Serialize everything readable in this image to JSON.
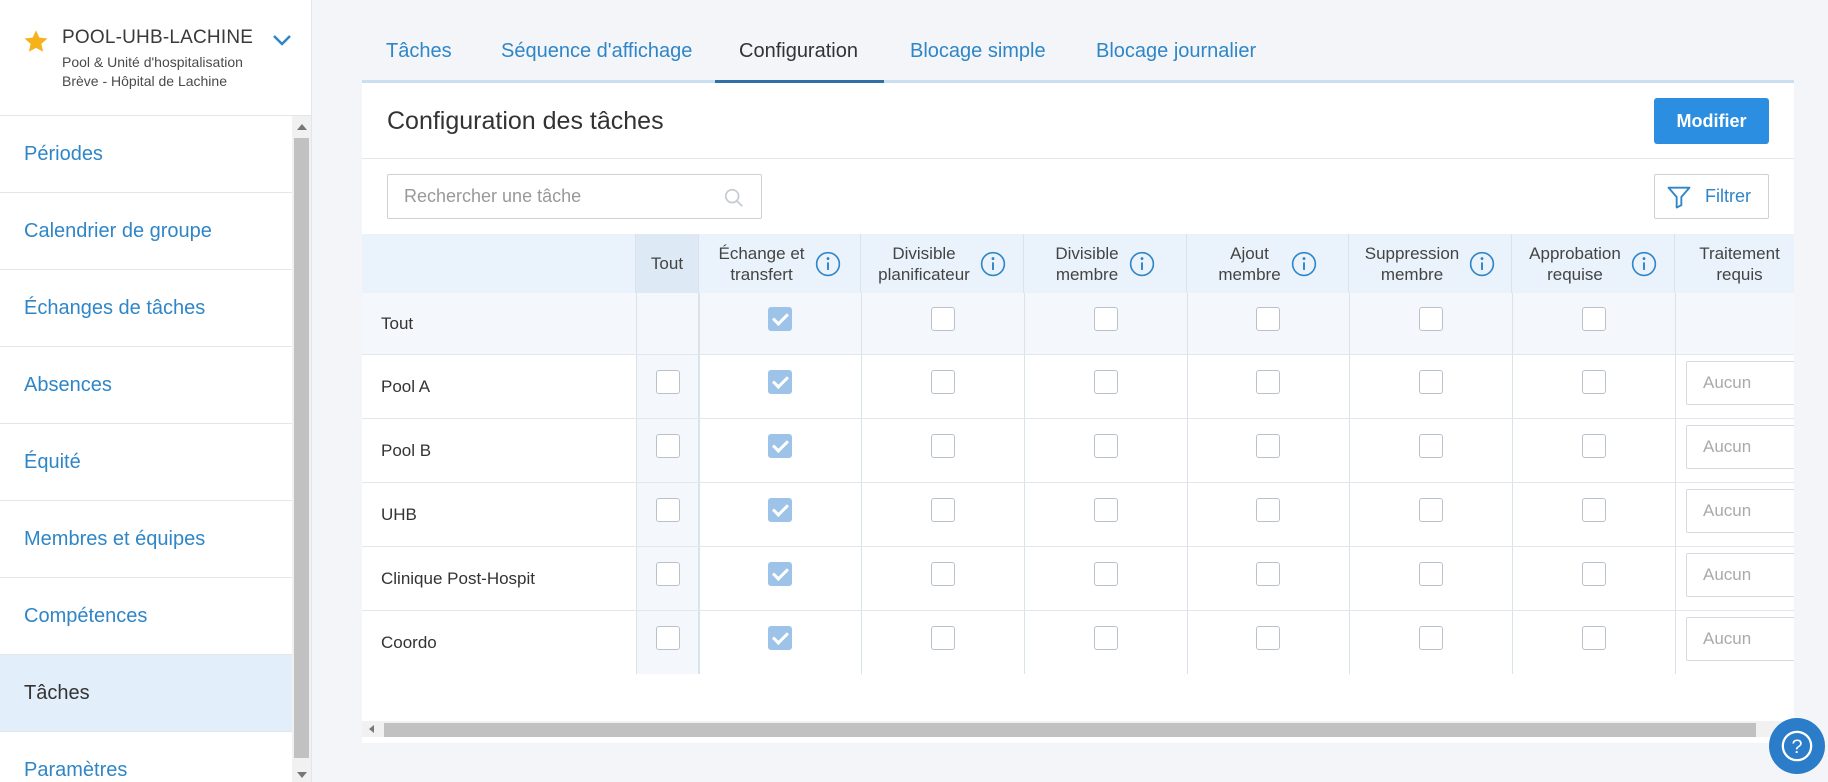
{
  "sidebar": {
    "title": "POOL-UHB-LACHINE",
    "subtitle": "Pool & Unité d'hospitalisation Brève - Hôpital de Lachine",
    "items": [
      {
        "label": "Périodes"
      },
      {
        "label": "Calendrier de groupe"
      },
      {
        "label": "Échanges de tâches"
      },
      {
        "label": "Absences"
      },
      {
        "label": "Équité"
      },
      {
        "label": "Membres et équipes"
      },
      {
        "label": "Compétences"
      },
      {
        "label": "Tâches"
      },
      {
        "label": "Paramètres"
      }
    ],
    "active_item": "Tâches"
  },
  "tabs": [
    {
      "label": "Tâches"
    },
    {
      "label": "Séquence d'affichage"
    },
    {
      "label": "Configuration"
    },
    {
      "label": "Blocage simple"
    },
    {
      "label": "Blocage journalier"
    }
  ],
  "active_tab": "Configuration",
  "card": {
    "title": "Configuration des tâches",
    "modify_label": "Modifier",
    "filter_label": "Filtrer",
    "search_placeholder": "Rechercher une tâche"
  },
  "table": {
    "columns": [
      {
        "label": "Tout",
        "info": false
      },
      {
        "label": "Échange et\ntransfert",
        "info": true
      },
      {
        "label": "Divisible\nplanificateur",
        "info": true
      },
      {
        "label": "Divisible\nmembre",
        "info": true
      },
      {
        "label": "Ajout\nmembre",
        "info": true
      },
      {
        "label": "Suppression\nmembre",
        "info": true
      },
      {
        "label": "Approbation\nrequise",
        "info": true
      },
      {
        "label": "Traitement\nrequis",
        "info": false
      }
    ],
    "tout_row": {
      "label": "Tout",
      "checks": [
        true,
        false,
        false,
        false,
        false,
        false
      ]
    },
    "rows": [
      {
        "name": "Pool A",
        "tout": false,
        "checks": [
          true,
          false,
          false,
          false,
          false,
          false
        ],
        "traitement": "Aucun"
      },
      {
        "name": "Pool B",
        "tout": false,
        "checks": [
          true,
          false,
          false,
          false,
          false,
          false
        ],
        "traitement": "Aucun"
      },
      {
        "name": "UHB",
        "tout": false,
        "checks": [
          true,
          false,
          false,
          false,
          false,
          false
        ],
        "traitement": "Aucun"
      },
      {
        "name": "Clinique Post-Hospit",
        "tout": false,
        "checks": [
          true,
          false,
          false,
          false,
          false,
          false
        ],
        "traitement": "Aucun"
      },
      {
        "name": "Coordo",
        "tout": false,
        "checks": [
          true,
          false,
          false,
          false,
          false,
          false
        ],
        "traitement": "Aucun"
      }
    ]
  },
  "colors": {
    "primary": "#2b8ee0",
    "link": "#2f86c7",
    "checked": "#9dc3e8",
    "star": "#f5b21a"
  },
  "icons": {
    "star": "star-icon",
    "chevron": "chevron-down-icon",
    "search": "search-icon",
    "filter": "filter-icon",
    "info": "info-icon",
    "help": "help-icon"
  }
}
